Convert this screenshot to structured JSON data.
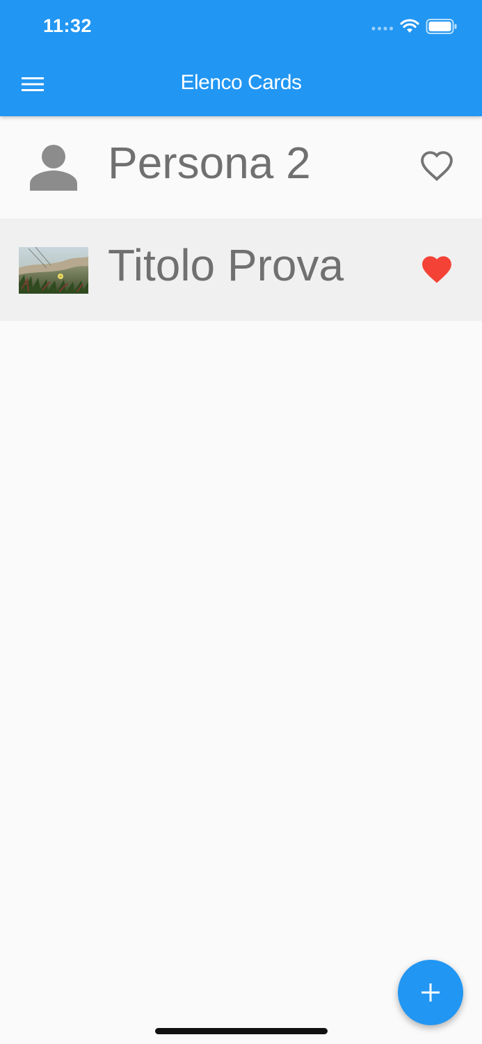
{
  "status_bar": {
    "time": "11:32",
    "icons": [
      "signal-dots-icon",
      "wifi-icon",
      "battery-icon"
    ]
  },
  "app_bar": {
    "title": "Elenco Cards",
    "menu_icon": "hamburger-menu-icon",
    "color": "#2196f3"
  },
  "list": {
    "items": [
      {
        "title": "Persona 2",
        "avatar": "person-icon",
        "favorite": false,
        "favorite_icon": "heart-outline-icon"
      },
      {
        "title": "Titolo Prova",
        "avatar": "photo-thumbnail",
        "favorite": true,
        "favorite_icon": "heart-filled-icon",
        "favorite_color": "#f44336",
        "selected": true
      }
    ]
  },
  "fab": {
    "icon": "plus-icon",
    "color": "#2196f3"
  }
}
